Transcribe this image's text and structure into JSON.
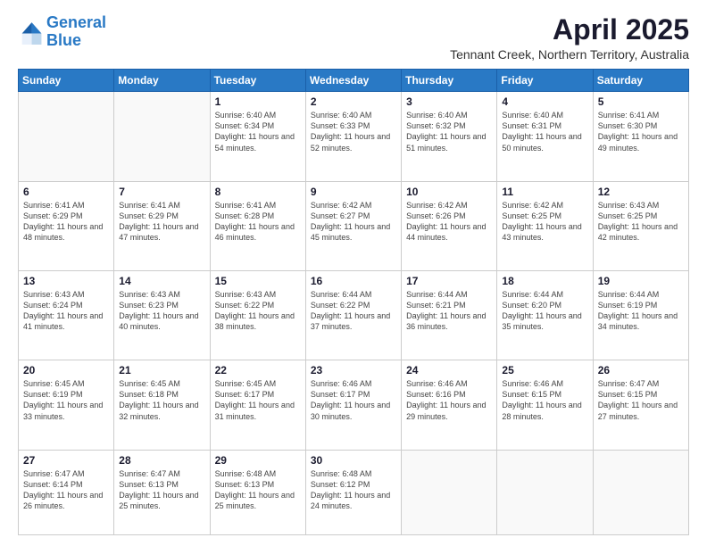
{
  "logo": {
    "line1": "General",
    "line2": "Blue"
  },
  "title": "April 2025",
  "subtitle": "Tennant Creek, Northern Territory, Australia",
  "days_of_week": [
    "Sunday",
    "Monday",
    "Tuesday",
    "Wednesday",
    "Thursday",
    "Friday",
    "Saturday"
  ],
  "weeks": [
    [
      {
        "day": "",
        "info": ""
      },
      {
        "day": "",
        "info": ""
      },
      {
        "day": "1",
        "info": "Sunrise: 6:40 AM\nSunset: 6:34 PM\nDaylight: 11 hours and 54 minutes."
      },
      {
        "day": "2",
        "info": "Sunrise: 6:40 AM\nSunset: 6:33 PM\nDaylight: 11 hours and 52 minutes."
      },
      {
        "day": "3",
        "info": "Sunrise: 6:40 AM\nSunset: 6:32 PM\nDaylight: 11 hours and 51 minutes."
      },
      {
        "day": "4",
        "info": "Sunrise: 6:40 AM\nSunset: 6:31 PM\nDaylight: 11 hours and 50 minutes."
      },
      {
        "day": "5",
        "info": "Sunrise: 6:41 AM\nSunset: 6:30 PM\nDaylight: 11 hours and 49 minutes."
      }
    ],
    [
      {
        "day": "6",
        "info": "Sunrise: 6:41 AM\nSunset: 6:29 PM\nDaylight: 11 hours and 48 minutes."
      },
      {
        "day": "7",
        "info": "Sunrise: 6:41 AM\nSunset: 6:29 PM\nDaylight: 11 hours and 47 minutes."
      },
      {
        "day": "8",
        "info": "Sunrise: 6:41 AM\nSunset: 6:28 PM\nDaylight: 11 hours and 46 minutes."
      },
      {
        "day": "9",
        "info": "Sunrise: 6:42 AM\nSunset: 6:27 PM\nDaylight: 11 hours and 45 minutes."
      },
      {
        "day": "10",
        "info": "Sunrise: 6:42 AM\nSunset: 6:26 PM\nDaylight: 11 hours and 44 minutes."
      },
      {
        "day": "11",
        "info": "Sunrise: 6:42 AM\nSunset: 6:25 PM\nDaylight: 11 hours and 43 minutes."
      },
      {
        "day": "12",
        "info": "Sunrise: 6:43 AM\nSunset: 6:25 PM\nDaylight: 11 hours and 42 minutes."
      }
    ],
    [
      {
        "day": "13",
        "info": "Sunrise: 6:43 AM\nSunset: 6:24 PM\nDaylight: 11 hours and 41 minutes."
      },
      {
        "day": "14",
        "info": "Sunrise: 6:43 AM\nSunset: 6:23 PM\nDaylight: 11 hours and 40 minutes."
      },
      {
        "day": "15",
        "info": "Sunrise: 6:43 AM\nSunset: 6:22 PM\nDaylight: 11 hours and 38 minutes."
      },
      {
        "day": "16",
        "info": "Sunrise: 6:44 AM\nSunset: 6:22 PM\nDaylight: 11 hours and 37 minutes."
      },
      {
        "day": "17",
        "info": "Sunrise: 6:44 AM\nSunset: 6:21 PM\nDaylight: 11 hours and 36 minutes."
      },
      {
        "day": "18",
        "info": "Sunrise: 6:44 AM\nSunset: 6:20 PM\nDaylight: 11 hours and 35 minutes."
      },
      {
        "day": "19",
        "info": "Sunrise: 6:44 AM\nSunset: 6:19 PM\nDaylight: 11 hours and 34 minutes."
      }
    ],
    [
      {
        "day": "20",
        "info": "Sunrise: 6:45 AM\nSunset: 6:19 PM\nDaylight: 11 hours and 33 minutes."
      },
      {
        "day": "21",
        "info": "Sunrise: 6:45 AM\nSunset: 6:18 PM\nDaylight: 11 hours and 32 minutes."
      },
      {
        "day": "22",
        "info": "Sunrise: 6:45 AM\nSunset: 6:17 PM\nDaylight: 11 hours and 31 minutes."
      },
      {
        "day": "23",
        "info": "Sunrise: 6:46 AM\nSunset: 6:17 PM\nDaylight: 11 hours and 30 minutes."
      },
      {
        "day": "24",
        "info": "Sunrise: 6:46 AM\nSunset: 6:16 PM\nDaylight: 11 hours and 29 minutes."
      },
      {
        "day": "25",
        "info": "Sunrise: 6:46 AM\nSunset: 6:15 PM\nDaylight: 11 hours and 28 minutes."
      },
      {
        "day": "26",
        "info": "Sunrise: 6:47 AM\nSunset: 6:15 PM\nDaylight: 11 hours and 27 minutes."
      }
    ],
    [
      {
        "day": "27",
        "info": "Sunrise: 6:47 AM\nSunset: 6:14 PM\nDaylight: 11 hours and 26 minutes."
      },
      {
        "day": "28",
        "info": "Sunrise: 6:47 AM\nSunset: 6:13 PM\nDaylight: 11 hours and 25 minutes."
      },
      {
        "day": "29",
        "info": "Sunrise: 6:48 AM\nSunset: 6:13 PM\nDaylight: 11 hours and 25 minutes."
      },
      {
        "day": "30",
        "info": "Sunrise: 6:48 AM\nSunset: 6:12 PM\nDaylight: 11 hours and 24 minutes."
      },
      {
        "day": "",
        "info": ""
      },
      {
        "day": "",
        "info": ""
      },
      {
        "day": "",
        "info": ""
      }
    ]
  ]
}
